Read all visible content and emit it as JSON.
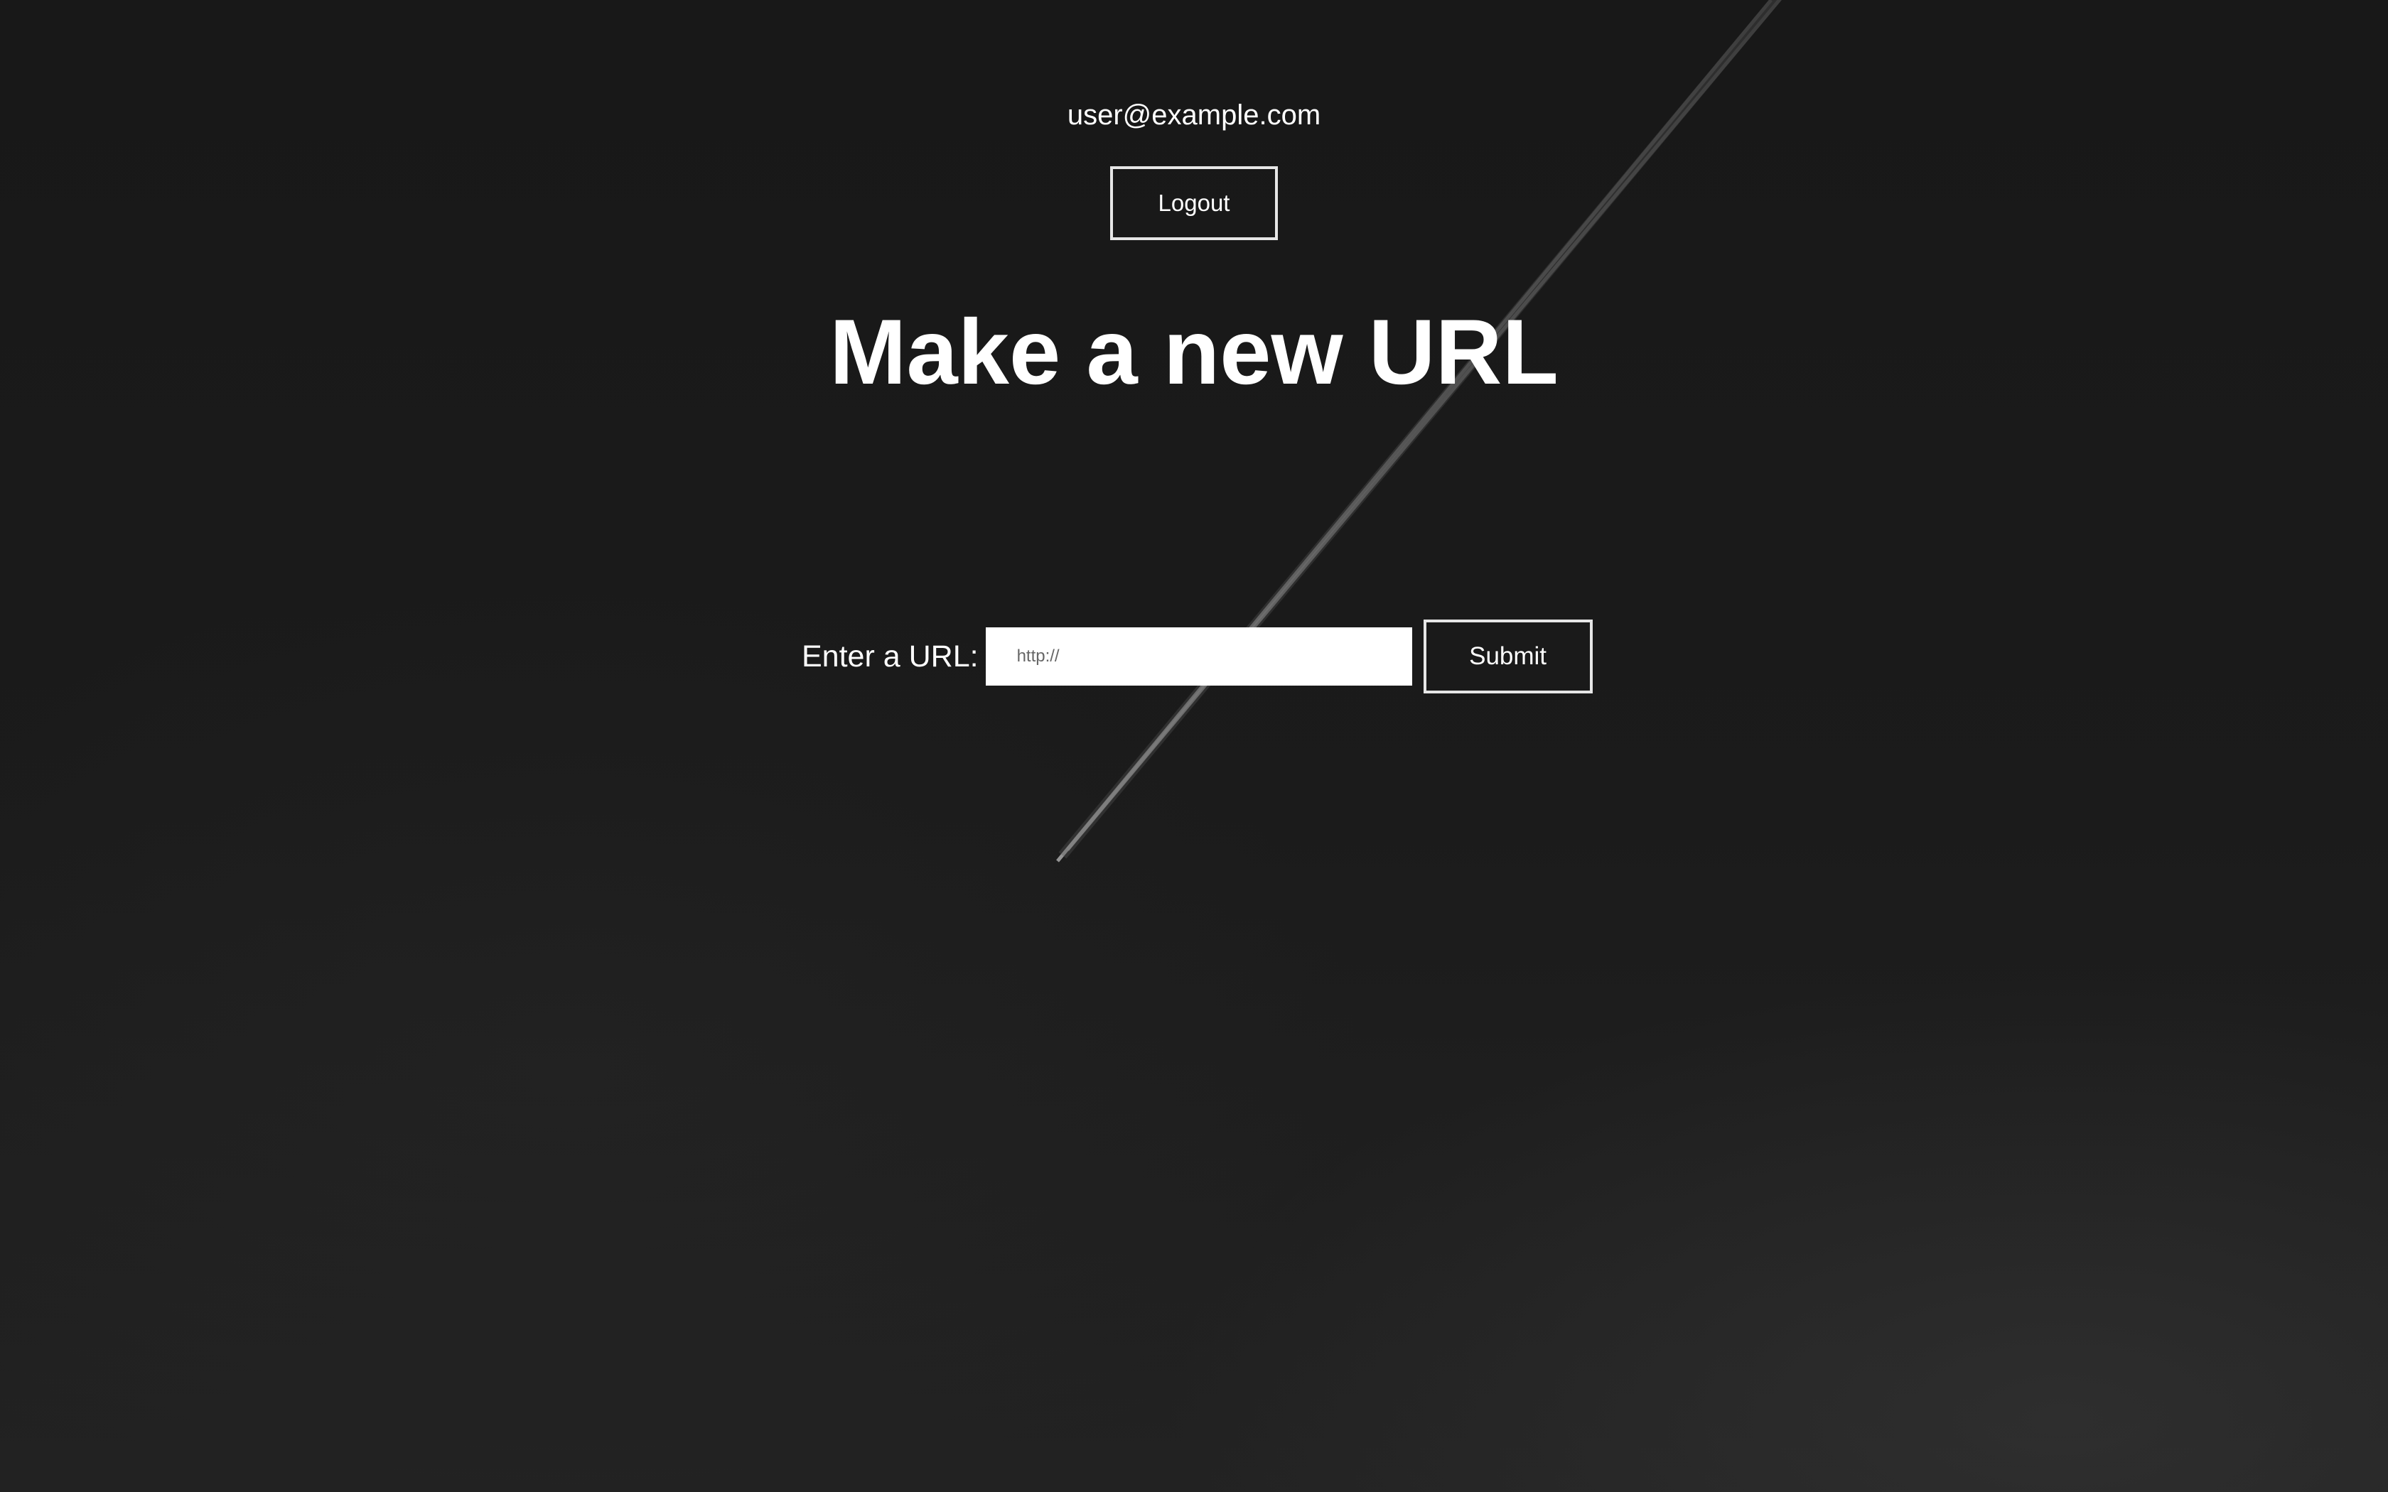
{
  "header": {
    "user_email": "user@example.com",
    "logout_label": "Logout"
  },
  "main": {
    "title": "Make a new URL",
    "form": {
      "label": "Enter a URL:",
      "input_placeholder": "http://",
      "input_value": "",
      "submit_label": "Submit"
    }
  },
  "colors": {
    "background": "#1a1a1a",
    "text": "#ffffff",
    "button_border": "#e6e6e6",
    "input_background": "#ffffff"
  }
}
